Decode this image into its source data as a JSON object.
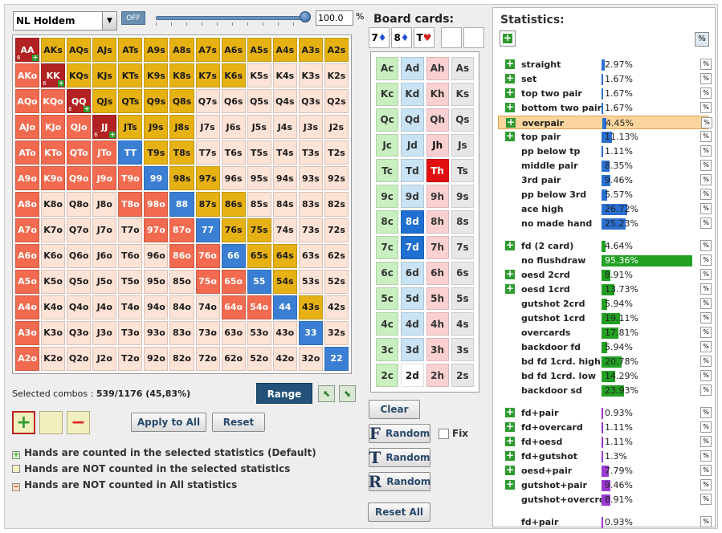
{
  "game": {
    "selected": "NL Holdem"
  },
  "off_label": "OFF",
  "range_pct": "100.0",
  "pct_sign": "%",
  "colors": {
    "pair_selected": "#b22222",
    "suited": "#e6b113",
    "offsuit": "#f26a4f",
    "pair": "#3a7fd4",
    "unselected": "#fde2d6",
    "tt": "#3a7fd4"
  },
  "hand_grid": [
    [
      "AA",
      "AKs",
      "AQs",
      "AJs",
      "ATs",
      "A9s",
      "A8s",
      "A7s",
      "A6s",
      "A5s",
      "A4s",
      "A3s",
      "A2s"
    ],
    [
      "AKo",
      "KK",
      "KQs",
      "KJs",
      "KTs",
      "K9s",
      "K8s",
      "K7s",
      "K6s",
      "K5s",
      "K4s",
      "K3s",
      "K2s"
    ],
    [
      "AQo",
      "KQo",
      "QQ",
      "QJs",
      "QTs",
      "Q9s",
      "Q8s",
      "Q7s",
      "Q6s",
      "Q5s",
      "Q4s",
      "Q3s",
      "Q2s"
    ],
    [
      "AJo",
      "KJo",
      "QJo",
      "JJ",
      "JTs",
      "J9s",
      "J8s",
      "J7s",
      "J6s",
      "J5s",
      "J4s",
      "J3s",
      "J2s"
    ],
    [
      "ATo",
      "KTo",
      "QTo",
      "JTo",
      "TT",
      "T9s",
      "T8s",
      "T7s",
      "T6s",
      "T5s",
      "T4s",
      "T3s",
      "T2s"
    ],
    [
      "A9o",
      "K9o",
      "Q9o",
      "J9o",
      "T9o",
      "99",
      "98s",
      "97s",
      "96s",
      "95s",
      "94s",
      "93s",
      "92s"
    ],
    [
      "A8o",
      "K8o",
      "Q8o",
      "J8o",
      "T8o",
      "98o",
      "88",
      "87s",
      "86s",
      "85s",
      "84s",
      "83s",
      "82s"
    ],
    [
      "A7o",
      "K7o",
      "Q7o",
      "J7o",
      "T7o",
      "97o",
      "87o",
      "77",
      "76s",
      "75s",
      "74s",
      "73s",
      "72s"
    ],
    [
      "A6o",
      "K6o",
      "Q6o",
      "J6o",
      "T6o",
      "96o",
      "86o",
      "76o",
      "66",
      "65s",
      "64s",
      "63s",
      "62s"
    ],
    [
      "A5o",
      "K5o",
      "Q5o",
      "J5o",
      "T5o",
      "95o",
      "85o",
      "75o",
      "65o",
      "55",
      "54s",
      "53s",
      "52s"
    ],
    [
      "A4o",
      "K4o",
      "Q4o",
      "J4o",
      "T4o",
      "94o",
      "84o",
      "74o",
      "64o",
      "54o",
      "44",
      "43s",
      "42s"
    ],
    [
      "A3o",
      "K3o",
      "Q3o",
      "J3o",
      "T3o",
      "93o",
      "83o",
      "73o",
      "63o",
      "53o",
      "43o",
      "33",
      "32s"
    ],
    [
      "A2o",
      "K2o",
      "Q2o",
      "J2o",
      "T2o",
      "92o",
      "82o",
      "72o",
      "62o",
      "52o",
      "42o",
      "32o",
      "22"
    ]
  ],
  "hand_states": [
    "PYYYYYYYYYYYY",
    "RPYYYYYYYWWWW",
    "RRPYYYYWWWWWW",
    "RRRPYYYWWWWWW",
    "RRRRBYYWWWWWW",
    "RRRRRBYYWWWWW",
    "RWWWRRBYYWWWW",
    "RWWWWRRBYYWWW",
    "RWWWWWRRBYYWW",
    "RWWWWWWRRBYWW",
    "RWWWWWWWRRBYW",
    "RWWWWWWWWWWBW",
    "RWWWWWWWWWWWB"
  ],
  "combo_markers": {
    "AA": "6",
    "KK": "6",
    "QQ": "6",
    "JJ": "6"
  },
  "selected": {
    "label": "Selected combos : ",
    "value": "539/1176 (45,83%)"
  },
  "buttons": {
    "range": "Range",
    "apply": "Apply to All",
    "reset": "Reset",
    "clear": "Clear",
    "random": "Random",
    "fix": "Fix",
    "reset_all": "Reset All"
  },
  "legend": [
    "Hands are counted in the selected statistics (Default)",
    "Hands are NOT counted in the selected statistics",
    "Hands are NOT counted in All statistics"
  ],
  "board": {
    "title": "Board cards:",
    "cards": [
      {
        "rank": "7",
        "suit": "♦",
        "color": "#1f4fd1"
      },
      {
        "rank": "8",
        "suit": "♦",
        "color": "#1f4fd1"
      },
      {
        "rank": "T",
        "suit": "♥",
        "color": "#d11f1f"
      }
    ]
  },
  "card_grid": [
    [
      "Ac",
      "Ad",
      "Ah",
      "As"
    ],
    [
      "Kc",
      "Kd",
      "Kh",
      "Ks"
    ],
    [
      "Qc",
      "Qd",
      "Qh",
      "Qs"
    ],
    [
      "Jc",
      "Jd",
      "Jh",
      "Js"
    ],
    [
      "Tc",
      "Td",
      "Th",
      "Ts"
    ],
    [
      "9c",
      "9d",
      "9h",
      "9s"
    ],
    [
      "8c",
      "8d",
      "8h",
      "8s"
    ],
    [
      "7c",
      "7d",
      "7h",
      "7s"
    ],
    [
      "6c",
      "6d",
      "6h",
      "6s"
    ],
    [
      "5c",
      "5d",
      "5h",
      "5s"
    ],
    [
      "4c",
      "4d",
      "4h",
      "4s"
    ],
    [
      "3c",
      "3d",
      "3h",
      "3s"
    ],
    [
      "2c",
      "2d",
      "2h",
      "2s"
    ]
  ],
  "card_special": {
    "8d": "sel-d",
    "7d": "sel-d",
    "Th": "sel-h",
    "2d": "white",
    "Jh": "pinkbold"
  },
  "stats": {
    "title": "Statistics:",
    "pct_icon": "%",
    "rows": [
      {
        "name": "straight",
        "value": "2.97%",
        "pct": 2.97,
        "plus": true,
        "color": "#2a6fd0"
      },
      {
        "name": "set",
        "value": "1.67%",
        "pct": 1.67,
        "plus": true,
        "color": "#2a6fd0"
      },
      {
        "name": "top two pair",
        "value": "1.67%",
        "pct": 1.67,
        "plus": true,
        "color": "#2a6fd0"
      },
      {
        "name": "bottom two pair",
        "value": "1.67%",
        "pct": 1.67,
        "plus": true,
        "color": "#2a6fd0"
      },
      {
        "name": "overpair",
        "value": "4.45%",
        "pct": 4.45,
        "plus": true,
        "color": "#2a6fd0",
        "hl": true
      },
      {
        "name": "top pair",
        "value": "11.13%",
        "pct": 11.13,
        "plus": true,
        "color": "#2a6fd0"
      },
      {
        "name": "pp below tp",
        "value": "1.11%",
        "pct": 1.11,
        "plus": false,
        "color": "#2a6fd0"
      },
      {
        "name": "middle pair",
        "value": "8.35%",
        "pct": 8.35,
        "plus": false,
        "color": "#2a6fd0"
      },
      {
        "name": "3rd pair",
        "value": "9.46%",
        "pct": 9.46,
        "plus": false,
        "color": "#2a6fd0"
      },
      {
        "name": "pp below 3rd",
        "value": "5.57%",
        "pct": 5.57,
        "plus": false,
        "color": "#2a6fd0"
      },
      {
        "name": "ace high",
        "value": "26.72%",
        "pct": 26.72,
        "plus": false,
        "color": "#2a6fd0"
      },
      {
        "name": "no made hand",
        "value": "25.23%",
        "pct": 25.23,
        "plus": false,
        "color": "#2a6fd0"
      },
      {
        "gap": true
      },
      {
        "name": "fd (2 card)",
        "value": "4.64%",
        "pct": 4.64,
        "plus": true,
        "color": "#22a022"
      },
      {
        "name": "no flushdraw",
        "value": "95.36%",
        "pct": 95.36,
        "plus": false,
        "color": "#22a022",
        "inside": true
      },
      {
        "name": "oesd 2crd",
        "value": "8.91%",
        "pct": 8.91,
        "plus": true,
        "color": "#22a022"
      },
      {
        "name": "oesd 1crd",
        "value": "13.73%",
        "pct": 13.73,
        "plus": true,
        "color": "#22a022"
      },
      {
        "name": "gutshot 2crd",
        "value": "5.94%",
        "pct": 5.94,
        "plus": false,
        "color": "#22a022"
      },
      {
        "name": "gutshot 1crd",
        "value": "19.11%",
        "pct": 19.11,
        "plus": false,
        "color": "#22a022"
      },
      {
        "name": "overcards",
        "value": "17.81%",
        "pct": 17.81,
        "plus": false,
        "color": "#22a022"
      },
      {
        "name": "backdoor fd",
        "value": "5.94%",
        "pct": 5.94,
        "plus": false,
        "color": "#22a022"
      },
      {
        "name": "bd fd 1crd. high",
        "value": "20.78%",
        "pct": 20.78,
        "plus": false,
        "color": "#22a022"
      },
      {
        "name": "bd fd 1crd. low",
        "value": "14.29%",
        "pct": 14.29,
        "plus": false,
        "color": "#22a022"
      },
      {
        "name": "backdoor sd",
        "value": "23.93%",
        "pct": 23.93,
        "plus": false,
        "color": "#22a022"
      },
      {
        "gap": true
      },
      {
        "name": "fd+pair",
        "value": "0.93%",
        "pct": 0.93,
        "plus": true,
        "color": "#9a3ad0"
      },
      {
        "name": "fd+overcard",
        "value": "1.11%",
        "pct": 1.11,
        "plus": true,
        "color": "#9a3ad0"
      },
      {
        "name": "fd+oesd",
        "value": "1.11%",
        "pct": 1.11,
        "plus": true,
        "color": "#9a3ad0"
      },
      {
        "name": "fd+gutshot",
        "value": "1.3%",
        "pct": 1.3,
        "plus": true,
        "color": "#9a3ad0"
      },
      {
        "name": "oesd+pair",
        "value": "7.79%",
        "pct": 7.79,
        "plus": true,
        "color": "#9a3ad0"
      },
      {
        "name": "gutshot+pair",
        "value": "9.46%",
        "pct": 9.46,
        "plus": true,
        "color": "#9a3ad0"
      },
      {
        "name": "gutshot+overcrd",
        "value": "8.91%",
        "pct": 8.91,
        "plus": false,
        "color": "#9a3ad0"
      },
      {
        "gap": true
      },
      {
        "name": "fd+pair",
        "value": "0.93%",
        "pct": 0.93,
        "plus": false,
        "color": "#9a3ad0"
      }
    ]
  }
}
